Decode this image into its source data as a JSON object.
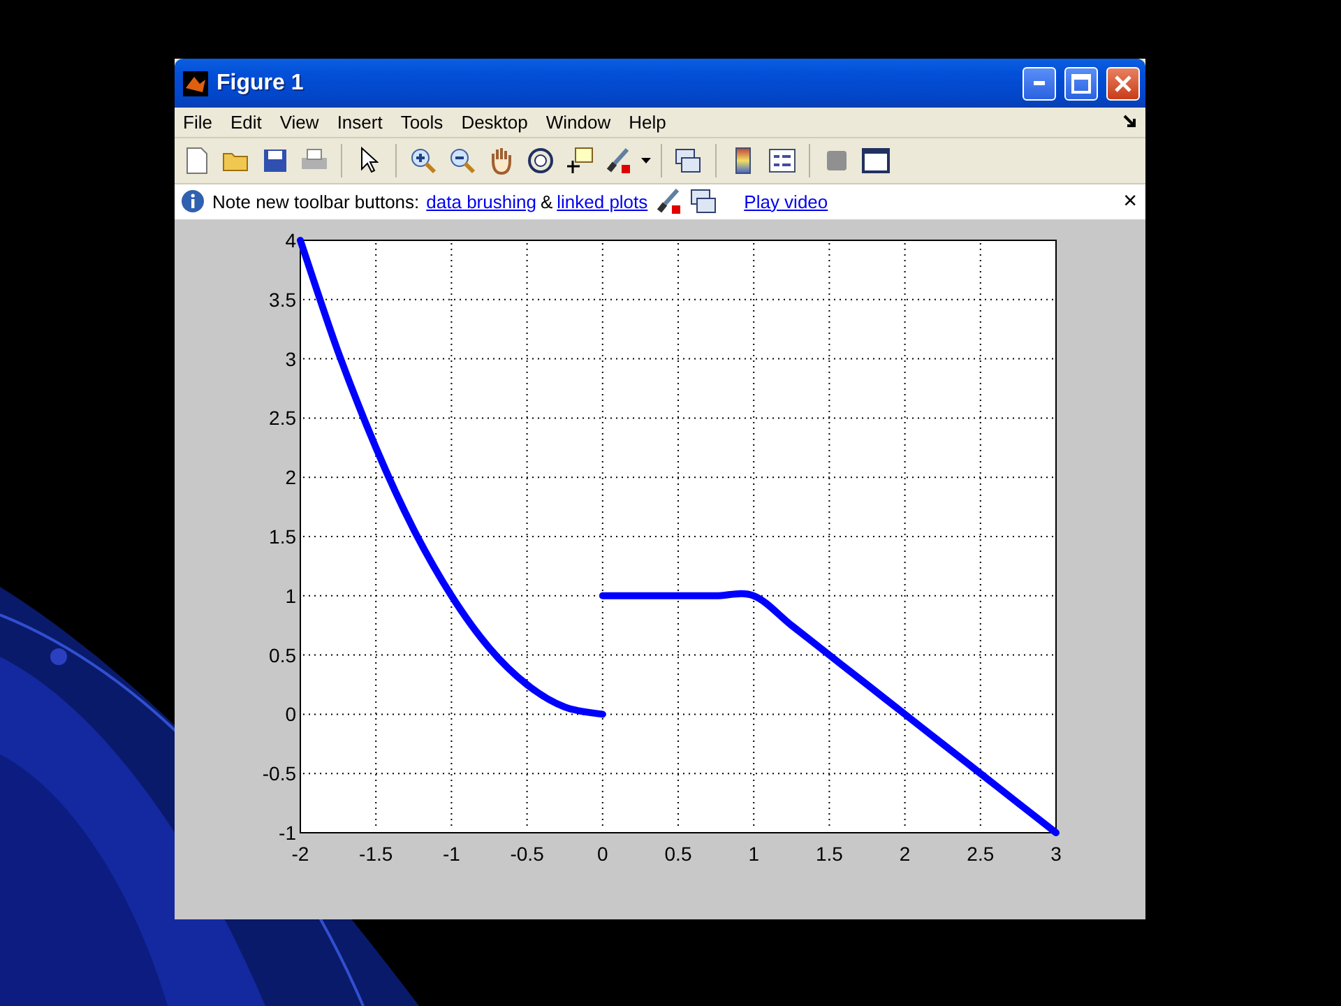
{
  "window": {
    "title": "Figure 1"
  },
  "menu": [
    "File",
    "Edit",
    "View",
    "Insert",
    "Tools",
    "Desktop",
    "Window",
    "Help"
  ],
  "info_bar": {
    "note": "Note new toolbar buttons:",
    "link_1": "data brushing",
    "joiner": "&",
    "link_2": "linked plots",
    "link_3": "Play video",
    "close": "×"
  },
  "chart_data": {
    "type": "line",
    "grid": true,
    "x": [
      -2,
      -1.75,
      -1.5,
      -1.25,
      -1,
      -0.75,
      -0.5,
      -0.25,
      0,
      0.25,
      0.5,
      0.75,
      1,
      1.25,
      1.5,
      1.75,
      2,
      2.25,
      2.5,
      2.75,
      3
    ],
    "series": [
      {
        "color": "#0000ff",
        "values": [
          4,
          3.06,
          2.25,
          1.56,
          1,
          0.56,
          0.25,
          0.06,
          0,
          null,
          null,
          null,
          null,
          null,
          null,
          null,
          null,
          null,
          null,
          null,
          null
        ]
      },
      {
        "color": "#0000ff",
        "values": [
          null,
          null,
          null,
          null,
          null,
          null,
          null,
          null,
          1,
          1,
          1,
          1,
          1,
          0.75,
          0.5,
          0.25,
          0,
          -0.25,
          -0.5,
          -0.75,
          -1
        ]
      }
    ],
    "xlim": [
      -2,
      3
    ],
    "ylim": [
      -1,
      4
    ],
    "xticks": [
      -2,
      -1.5,
      -1,
      -0.5,
      0,
      0.5,
      1,
      1.5,
      2,
      2.5,
      3
    ],
    "yticks": [
      -1,
      -0.5,
      0,
      0.5,
      1,
      1.5,
      2,
      2.5,
      3,
      3.5,
      4
    ]
  }
}
